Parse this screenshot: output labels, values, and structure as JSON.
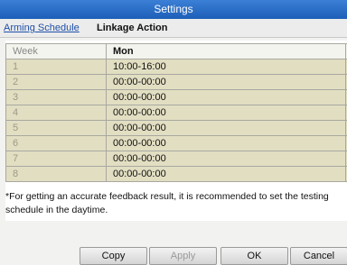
{
  "window": {
    "title": "Settings"
  },
  "tabs": [
    {
      "label": "Arming Schedule"
    },
    {
      "label": "Linkage Action"
    }
  ],
  "table": {
    "headers": {
      "week": "Week",
      "day": "Mon"
    },
    "rows": [
      {
        "week": "1",
        "time": "10:00-16:00"
      },
      {
        "week": "2",
        "time": "00:00-00:00"
      },
      {
        "week": "3",
        "time": "00:00-00:00"
      },
      {
        "week": "4",
        "time": "00:00-00:00"
      },
      {
        "week": "5",
        "time": "00:00-00:00"
      },
      {
        "week": "6",
        "time": "00:00-00:00"
      },
      {
        "week": "7",
        "time": "00:00-00:00"
      },
      {
        "week": "8",
        "time": "00:00-00:00"
      }
    ]
  },
  "note": "*For getting an accurate feedback result, it is recommended to set the testing schedule in the daytime.",
  "buttons": {
    "copy": "Copy",
    "apply": "Apply",
    "ok": "OK",
    "cancel": "Cancel"
  }
}
